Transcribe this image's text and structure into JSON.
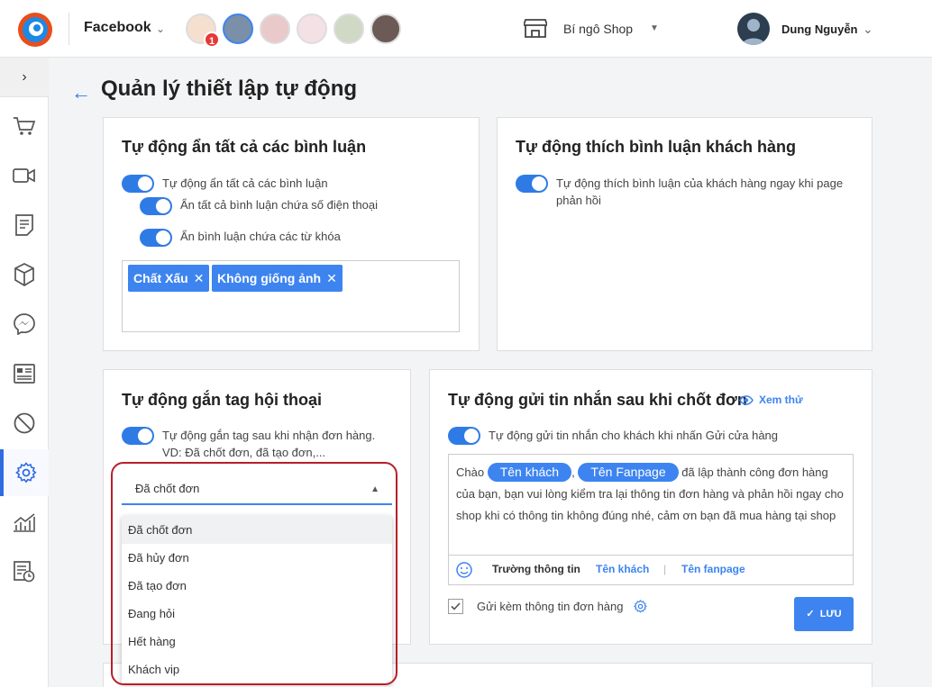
{
  "header": {
    "platform": "Facebook",
    "notification_count": "1",
    "shop_name": "Bí ngô Shop",
    "user_name": "Dung Nguyễn"
  },
  "sidebar": {
    "items": [
      "cart-icon",
      "video-icon",
      "order-doc-icon",
      "box-icon",
      "messenger-icon",
      "contact-card-icon",
      "block-icon",
      "settings-icon",
      "chart-icon",
      "report-icon"
    ]
  },
  "page": {
    "title": "Quản lý thiết lập tự động"
  },
  "card_hide": {
    "title": "Tự động ẩn tất cả các bình luận",
    "toggle_all": "Tự động ẩn tất cả các bình luận",
    "toggle_phone": "Ẩn tất cả bình luận chứa số điện thoại",
    "toggle_keyword": "Ẩn bình luận chứa các từ khóa",
    "keywords": [
      "Chất Xấu",
      "Không giống ảnh"
    ]
  },
  "card_like": {
    "title": "Tự động thích bình luận khách hàng",
    "toggle": "Tự động thích bình luận của khách hàng ngay khi page phản hồi"
  },
  "card_tag": {
    "title": "Tự động gắn tag hội thoại",
    "toggle": "Tự động gắn tag sau khi nhận đơn hàng. VD: Đã chốt đơn, đã tạo đơn,...",
    "selected": "Đã chốt đơn",
    "options": [
      "Đã chốt đơn",
      "Đã hủy đơn",
      "Đã tạo đơn",
      "Đang hỏi",
      "Hết hàng",
      "Khách vip"
    ]
  },
  "card_msg": {
    "title": "Tự động gửi tin nhắn sau khi chốt đơn",
    "preview": "Xem thử",
    "toggle": "Tự động gửi tin nhắn cho khách khi nhấn Gửi cửa hàng",
    "msg_prefix": "Chào",
    "chip_customer": "Tên khách",
    "comma": ",",
    "chip_fanpage": "Tên Fanpage",
    "msg_body": "đã lập thành công đơn hàng của bạn, bạn vui lòng kiểm tra lại thông tin đơn hàng và phản hồi ngay cho shop khi có thông tin không đúng nhé, cảm ơn bạn đã mua hàng tại shop",
    "fields_label": "Trường thông tin",
    "field_customer": "Tên khách",
    "field_sep": "|",
    "field_fanpage": "Tên fanpage",
    "attach_label": "Gửi kèm thông tin đơn hàng",
    "save": "LƯU"
  },
  "colors": {
    "accent": "#3d84f0",
    "highlight": "#b5202a"
  }
}
